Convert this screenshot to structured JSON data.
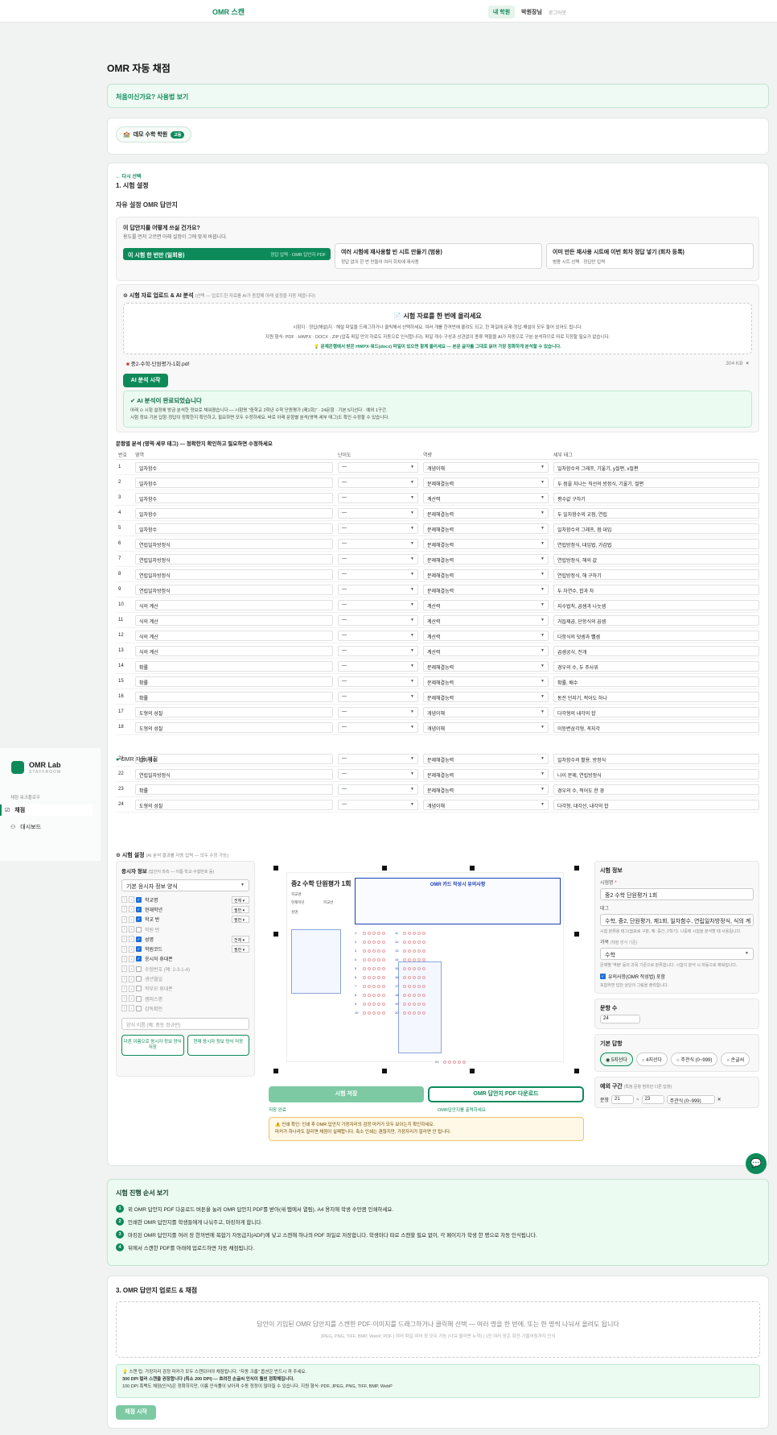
{
  "topbar": {
    "brand": "OMR 스캔",
    "nav_active": "내 학원",
    "user": "박원장님",
    "logout": "로그아웃"
  },
  "page": {
    "title": "OMR 자동 채점",
    "help": "처음이신가요? 사용법 보기"
  },
  "academy": {
    "name": "데모 수학 학원",
    "badge": "고등"
  },
  "setup": {
    "back": "← 다시 선택",
    "step": "1. 시험 설정",
    "mode": "자유 설정 OMR 답안지",
    "question": "이 답안지를 어떻게 쓰실 건가요?",
    "question_sub": "용도를 먼저 고르면 아래 설정이 그에 맞게 바뀝니다.",
    "options": [
      {
        "title": "이 시험 한 번만 (일회용)",
        "desc": "정답 입력 · OMR 답안지 PDF"
      },
      {
        "title": "여러 시험에 재사용할 빈 시트 만들기 (범용)",
        "desc": "정답 없이 한 번 만들어 여러 회차에 재사용"
      },
      {
        "title": "이미 만든 재사용 시트에 이번 회차 정답 넣기 (회차 등록)",
        "desc": "범용 시트 선택 · 정답만 입력"
      }
    ]
  },
  "upload_ai": {
    "title": "⊙ 시험 자료 업로드 & AI 분석",
    "title_note": "(선택 — 업로드한 자료를 AI가 종합해 아래 설정을 자동 채웁니다)",
    "drop_title": "📄 시험 자료를 한 번에 올리세요",
    "drop_line1": "시험지 · 정답(해설)지 · 해설 파일을 드래그하거나 클릭해서 선택하세요. 여러 개를 한꺼번에 올려도 되고, 한 파일에 문제·정답·해설이 모두 들어 있어도 됩니다.",
    "drop_line2": "지원 형식: PDF · HWPX · DOCX · ZIP (압축 파일 안의 자료도 자동으로 인식합니다). 파일 개수·구성과 상관없이 종류·역할을 AI가 자동으로 구분·분석하므로 따로 지정할 필요가 없습니다.",
    "drop_hint": "💡 문제은행에서 받은 HWPX·워드(docx) 파일이 있으면 함께 올리세요 — 본문 글자를 그대로 읽어 가장 정확하게 분석할 수 있습니다.",
    "file_name": "중2-수학-단원평가-1회.pdf",
    "file_size": "304 KB",
    "close": "×",
    "button": "AI 분석 시작",
    "done_title": "✔ AI 분석이 완료되었습니다",
    "done_line1": "아래 ⊙ 시험 설정에 방금 분석한 정보로 채워졌습니다 — 시험명 \"중학교 2학년 수학 단원평가 (제1회)\" · 24문항 · 기본 5지선다 · 예외 1구간.",
    "done_line2": "시험 정보·기본 답항·정답이 정확한지 확인하고, 필요하면 모두 수정하세요. 바로 아래 문항별 분석(영역·세부 태그)도 확인·수정할 수 있습니다."
  },
  "analysis": {
    "title": "문항별 분석 (영역·세부 태그) — 정확한지 확인하고 필요하면 수정하세요",
    "headers": [
      "번호",
      "영역",
      "난이도",
      "역량",
      "세부 태그"
    ],
    "rows": [
      [
        "1",
        "일차함수",
        "—",
        "개념이해",
        "일차함수의 그래프, 기울기, y절편, x절편"
      ],
      [
        "2",
        "일차함수",
        "—",
        "문제해결능력",
        "두 점을 지나는 직선의 방정식, 기울기, 절편"
      ],
      [
        "3",
        "일차함수",
        "—",
        "계산력",
        "평수값 구하기"
      ],
      [
        "4",
        "일차함수",
        "—",
        "문제해결능력",
        "두 일차함수의 교점, 연립"
      ],
      [
        "5",
        "일차함수",
        "—",
        "문제해결능력",
        "일차함수의 그래프, 점 대입"
      ],
      [
        "6",
        "연립일차방정식",
        "—",
        "문제해결능력",
        "연립방정식, 대입법, 가감법"
      ],
      [
        "7",
        "연립일차방정식",
        "—",
        "문제해결능력",
        "연립방정식, 해의 값"
      ],
      [
        "8",
        "연립일차방정식",
        "—",
        "문제해결능력",
        "연립방정식, 해 구하기"
      ],
      [
        "9",
        "연립일차방정식",
        "—",
        "문제해결능력",
        "두 자연수, 합과 차"
      ],
      [
        "10",
        "식의 계산",
        "—",
        "계산력",
        "지수법칙, 곱셈과 나눗셈"
      ],
      [
        "11",
        "식의 계산",
        "—",
        "계산력",
        "거듭제곱, 단항식의 곱셈"
      ],
      [
        "12",
        "식의 계산",
        "—",
        "계산력",
        "다항식의 덧셈과 뺄셈"
      ],
      [
        "13",
        "식의 계산",
        "—",
        "계산력",
        "곱셈공식, 전개"
      ],
      [
        "14",
        "확률",
        "—",
        "문제해결능력",
        "경우의 수, 두 주사위"
      ],
      [
        "15",
        "확률",
        "—",
        "문제해결능력",
        "확률, 배수"
      ],
      [
        "16",
        "확률",
        "—",
        "문제해결능력",
        "동전 던지기, 적어도 하나"
      ],
      [
        "17",
        "도형의 성질",
        "—",
        "개념이해",
        "다각형의 내각의 합"
      ],
      [
        "18",
        "도형의 성질",
        "—",
        "개념이해",
        "이등변삼각형, 꼭지각"
      ],
      [
        "21",
        "일차함수",
        "—",
        "문제해결능력",
        "일차함수의 활용, 방정식"
      ],
      [
        "22",
        "연립일차방정식",
        "—",
        "문제해결능력",
        "나이 문제, 연립방정식"
      ],
      [
        "23",
        "확률",
        "—",
        "문제해결능력",
        "경우의 수, 적어도 한 경"
      ],
      [
        "24",
        "도형의 성질",
        "—",
        "개념이해",
        "다각형, 대각선, 내각의 합"
      ]
    ]
  },
  "exam_setting": {
    "title": "⊙ 시험 설정",
    "note": "(AI 분석 결과를 자동 입력 — 모두 수정 가능)"
  },
  "applicant": {
    "title": "응시자 정보",
    "note": "(답안지 좌측 — 이름·학교·수험번호 등)",
    "preset": "기본 응시자 정보 양식",
    "fields": [
      {
        "name": "학교명",
        "on": true,
        "mode": "전체"
      },
      {
        "name": "현재학년",
        "on": true,
        "mode": "필번"
      },
      {
        "name": "학교 반",
        "on": true,
        "mode": "필번"
      },
      {
        "name": "학원 반",
        "on": false,
        "mode": ""
      },
      {
        "name": "성명",
        "on": true,
        "mode": "전체"
      },
      {
        "name": "학원코드",
        "on": true,
        "mode": "필번"
      },
      {
        "name": "응시자 휴대폰",
        "on": true,
        "mode": ""
      },
      {
        "name": "수험번호 (예: 2-3-1-4)",
        "on": false,
        "mode": ""
      },
      {
        "name": "생년월일",
        "on": false,
        "mode": ""
      },
      {
        "name": "학부모 휴대폰",
        "on": false,
        "mode": ""
      },
      {
        "name": "캠퍼스명",
        "on": false,
        "mode": ""
      },
      {
        "name": "감독확인",
        "on": false,
        "mode": ""
      }
    ],
    "save_placeholder": "양식 이름 (예: 중등 정규반)",
    "btn_save": "다른 이름으로 응시자 정보 양식 저장",
    "btn_update": "현재 응시자 정보 양식 저장"
  },
  "sheet": {
    "title": "중2 수학 단원평가 1회",
    "rules_title": "OMR 카드 작성시 유의사항",
    "labels": [
      "학교명",
      "현재학년",
      "학교반",
      "성명"
    ]
  },
  "actions": {
    "save": "시험 저장",
    "save_note": "저장 완료",
    "pdf": "OMR 답안지 PDF 다운로드",
    "pdf_note": "OMR답안지를 출력하세요",
    "warn1": "⚠️ 인쇄 확인: 인쇄 후 OMR 답안지 가장자리의 검정 마커가 모두 보이는지 확인하세요.",
    "warn2": "마커가 하나라도 잘리면 채점이 실패합니다. 축소 인쇄는 괜찮지만, 가장자리가 잘리면 안 됩니다."
  },
  "exam_info": {
    "title": "시험 정보",
    "name_label": "시험명",
    "name_value": "중2 수학 단원평가 1회",
    "tag_label": "태그",
    "tag_value": "수학, 중2, 단원평가, 제1회, 일차함수, 연립일차방정식, 식의 계",
    "tag_hint": "시험 분류용 태그(쉼표로 구분, 예: 중간, 2학기). 나중에 시험을 분석할 때 사용됩니다.",
    "subject_label": "과목",
    "subject_hint": "(채점 방식 기준)",
    "subject_value": "수학",
    "subject_note": "문제별 '역량' 등의 과목 기준으로 분류합니다. 시험의 분석 시 자동으로 채워집니다.",
    "essay": "유의사항(OMR 작성법) 포함",
    "essay_hint": "포함하면 답안 상단의 그림을 출력합니다."
  },
  "count": {
    "title": "문항 수",
    "value": "24"
  },
  "answer": {
    "title": "기본 답항",
    "options": [
      "5지선다",
      "4지선다",
      "주관식 (0~999)",
      "손글씨"
    ]
  },
  "exception": {
    "title": "예외 구간",
    "note": "(특정 문항 범위만 다른 답항)",
    "from_label": "문항",
    "from": "21",
    "to": "23",
    "type": "주관식 (0~999)",
    "remove": "✕"
  },
  "guide": {
    "title": "시험 진행 순서 보기",
    "steps": [
      "위 OMR 답안지 PDF 다운로드 버튼을 눌러 OMR 답안지 PDF를 받아(새 탭에서 열림), A4 용지에 학생 수만큼 인쇄하세요.",
      "인쇄한 OMR 답안지를 학생들에게 나눠주고, 마킹하게 합니다.",
      "마킹된 OMR 답안지를 여러 장 한꺼번에 복합기 자동급지(ADF)에 넣고 스캔해 하나의 PDF 파일로 저장합니다. 학생마다 따로 스캔할 필요 없이, 각 페이지가 학생 한 명으로 자동 인식됩니다.",
      "뒤에서 스캔한 PDF를 아래에 업로드하면 자동 채점됩니다."
    ]
  },
  "upload": {
    "title": "3. OMR 답안지 업로드 & 채점",
    "drop": "답안이 기입된 OMR 답안지를 스캔한 PDF·이미지를 드래그하거나 클릭해 선택 — 여러 명을 한 번에, 또는 한 명씩 나눠서 올려도 됩니다",
    "formats": "JPEG, PNG, TIFF, BMP, WebP, PDF | 여러 파일·여러 장 모두 가능 (나눠 올리면 누적) | 1인 여러 장은 회전·기울어짐까지 인식",
    "tip1": "💡 스캔 팁: 가장자리 검정 마커가 모두 스캔되어야 채점됩니다. \"자동 크롭\" 옵션은 반드시 꺼 주세요.",
    "tip2": "300 DPI 컬러 스캔을 권장합니다 (최소 200 DPI) — 흐려진 손글씨 인식이 훨씬 정확해집니다.",
    "tip3": "100 DPI 흑백도 채점(인식)은 정확하지만, 이름 인식률이 낮아져 수동 정정이 많아질 수 있습니다. 지원 형식: PDF, JPEG, PNG, TIFF, BMP, WebP",
    "button": "채점 시작"
  },
  "sidebar": {
    "logo": "OMR Lab",
    "sub": "STAFFROOM",
    "group": "채점 워크플로우",
    "items": [
      "채점",
      "대시보드"
    ],
    "crumb": "OMR 자동 채점"
  },
  "colors": {
    "accent": "#0d8a5a",
    "sheet_blue": "#1e3fb4"
  }
}
